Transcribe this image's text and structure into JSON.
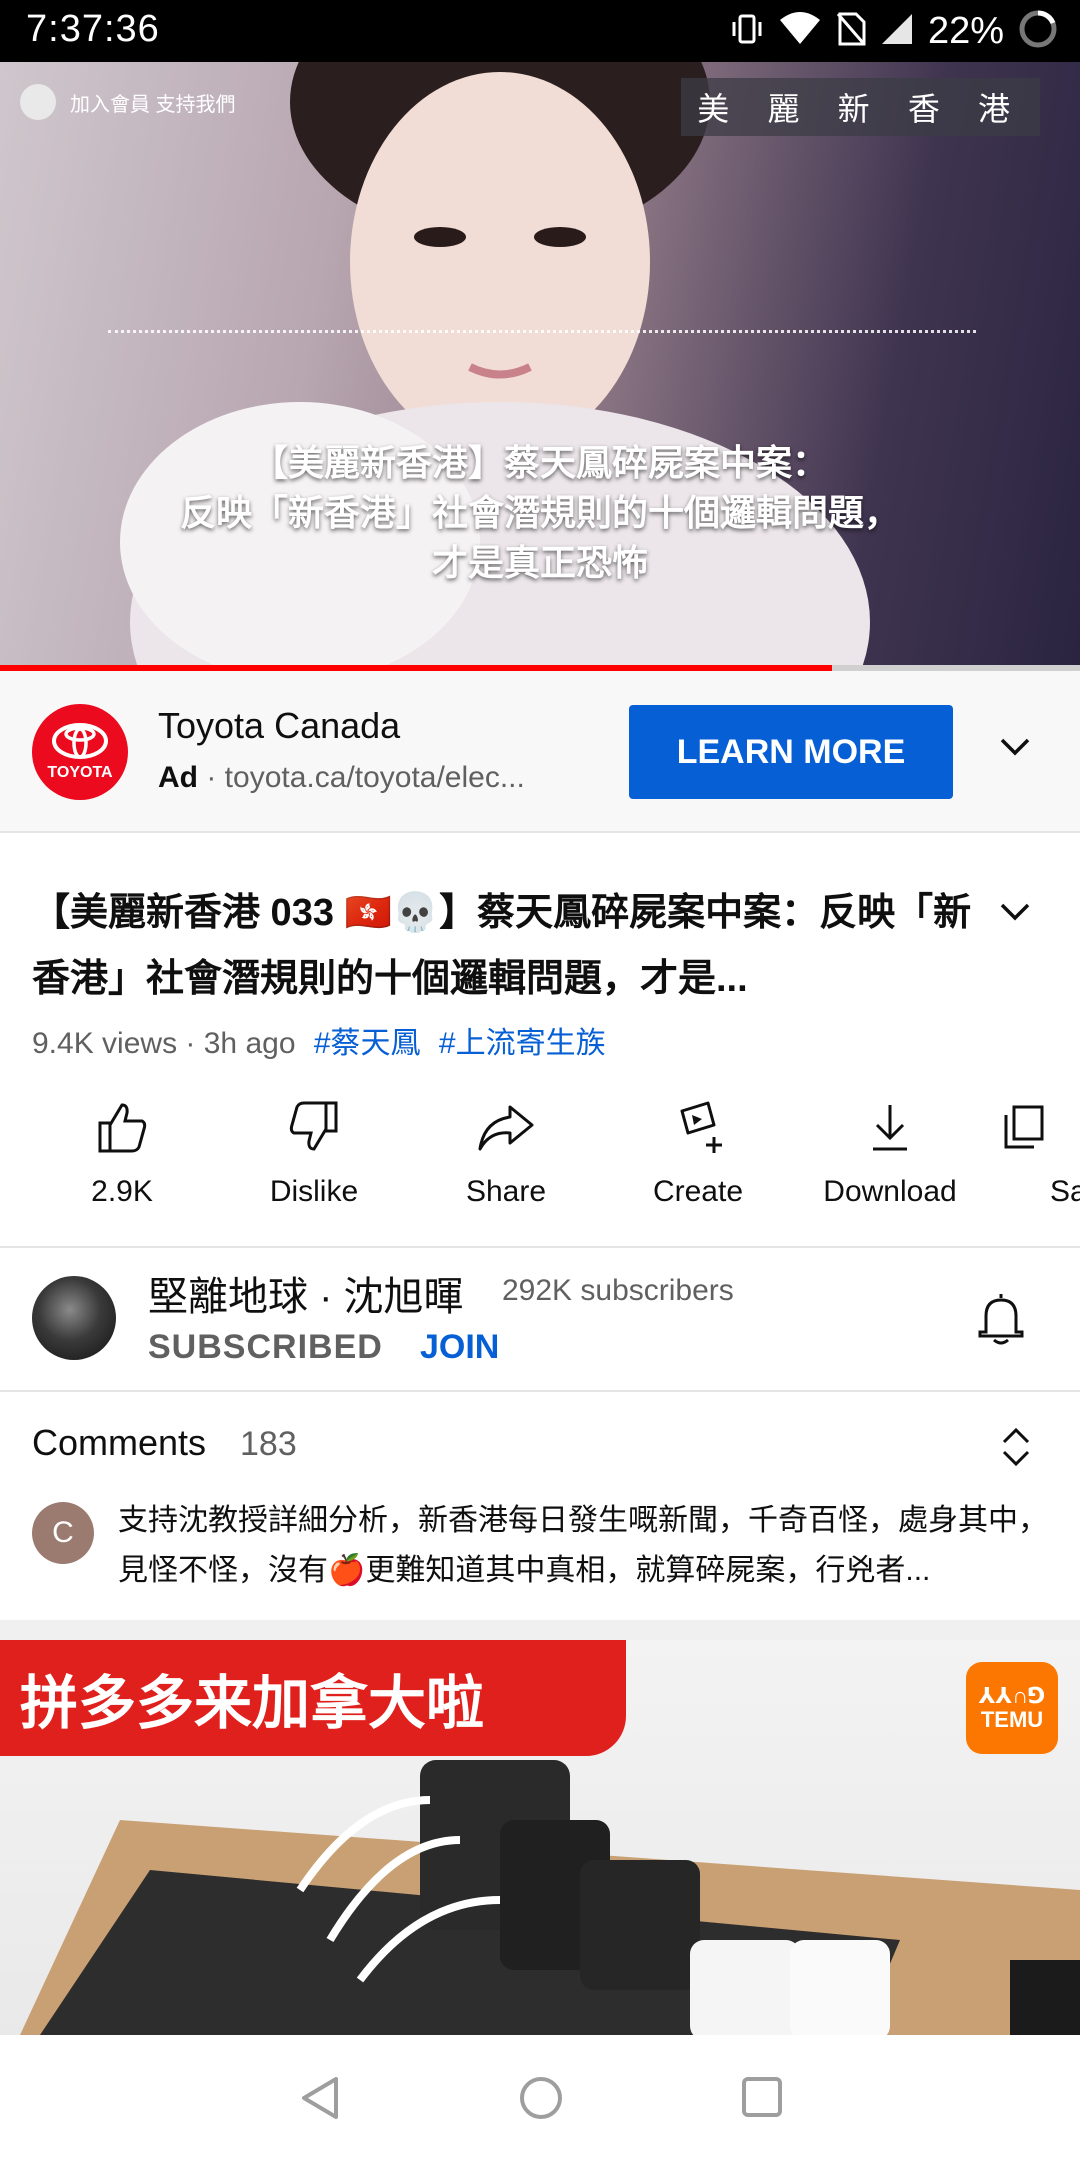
{
  "status_bar": {
    "time": "7:37:36",
    "battery": "22%"
  },
  "video": {
    "top_left_text": "加入會員 支持我們",
    "badge": "美 麗 新 香 港",
    "caption_lines": [
      "【美麗新香港】蔡天鳳碎屍案中案：",
      "反映「新香港」社會潛規則的十個邏輯問題，",
      "才是真正恐怖"
    ],
    "progress": 0.77,
    "progress_color": "#ff0000"
  },
  "ad": {
    "advertiser": "Toyota Canada",
    "logo_text": "TOYOTA",
    "label": "Ad",
    "url": "toyota.ca/toyota/elec...",
    "cta": "LEARN MORE",
    "accent": "#065fd4"
  },
  "title": {
    "text": "【美麗新香港 033 🇭🇰💀】蔡天鳳碎屍案中案：反映「新香港」社會潛規則的十個邏輯問題，才是...",
    "views": "9.4K views",
    "age": "3h ago",
    "hashtags": [
      "#蔡天鳳",
      "#上流寄生族"
    ]
  },
  "actions": [
    {
      "label": "2.9K",
      "icon": "thumb-up-icon"
    },
    {
      "label": "Dislike",
      "icon": "thumb-down-icon"
    },
    {
      "label": "Share",
      "icon": "share-icon"
    },
    {
      "label": "Create",
      "icon": "create-icon"
    },
    {
      "label": "Download",
      "icon": "download-icon"
    },
    {
      "label": "Sa",
      "icon": "save-icon"
    }
  ],
  "channel": {
    "name": "堅離地球 · 沈旭暉",
    "subscribers": "292K subscribers",
    "subscribed_label": "SUBSCRIBED",
    "join_label": "JOIN"
  },
  "comments": {
    "header": "Comments",
    "count": "183",
    "first_avatar_letter": "C",
    "first_comment": "支持沈教授詳細分析，新香港每日發生嘅新聞，千奇百怪，處身其中，見怪不怪，沒有🍎更難知道其中真相，就算碎屍案，行兇者..."
  },
  "promo": {
    "banner_text": "拼多多来加拿大啦",
    "logo_top": "⅄⅄∩⅁",
    "logo_text": "TEMU",
    "brand_color": "#fb7701"
  }
}
